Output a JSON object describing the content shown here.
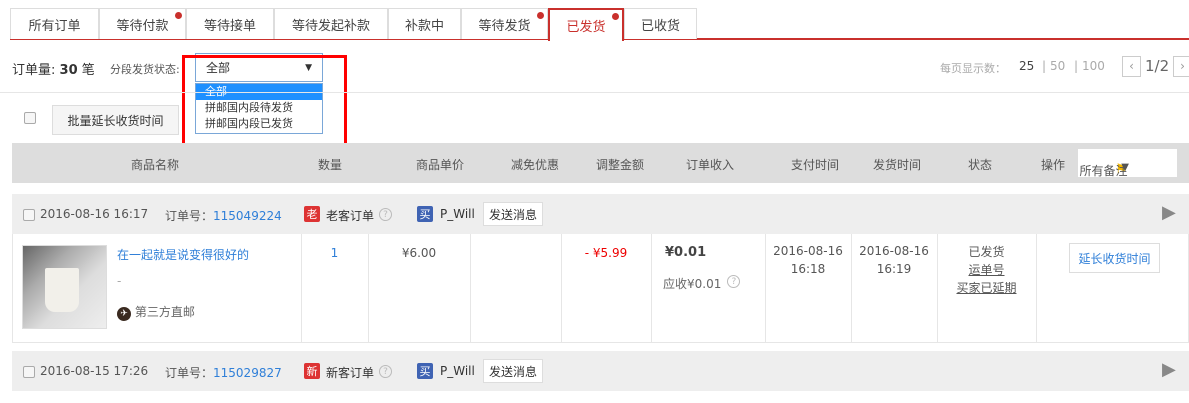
{
  "tabs": [
    {
      "label": "所有订单",
      "dot": false
    },
    {
      "label": "等待付款",
      "dot": true
    },
    {
      "label": "等待接单",
      "dot": false
    },
    {
      "label": "等待发起补款",
      "dot": false
    },
    {
      "label": "补款中",
      "dot": false
    },
    {
      "label": "等待发货",
      "dot": true
    },
    {
      "label": "已发货",
      "dot": true,
      "active": true
    },
    {
      "label": "已收货",
      "dot": false
    }
  ],
  "toolbar": {
    "count_label": "订单量:",
    "count": "30",
    "count_unit": "笔",
    "filter_label": "分段发货状态:",
    "filter_value": "全部",
    "filter_options": [
      "全部",
      "拼邮国内段待发货",
      "拼邮国内段已发货"
    ],
    "per_page_label": "每页显示数：",
    "per_page": [
      "25",
      "50",
      "100"
    ],
    "page": "1/2",
    "batch_button": "批量延长收货时间"
  },
  "columns": [
    "商品名称",
    "数量",
    "商品单价",
    "减免优惠",
    "调整金额",
    "订单收入",
    "支付时间",
    "发货时间",
    "状态",
    "操作"
  ],
  "notes_filter": "所有备注",
  "orders": [
    {
      "time": "2016-08-16 16:17",
      "order_no_label": "订单号：",
      "order_no": "115049224",
      "customer_badge": "老",
      "customer_type": "老客订单",
      "buyer_badge": "买",
      "buyer": "P_Will",
      "send_msg": "发送消息",
      "product": "在一起就是说变得很好的",
      "spec": "-",
      "shipping": "第三方直邮",
      "qty": "1",
      "price": "¥6.00",
      "discount": "",
      "adjust": "- ¥5.99",
      "income": "¥0.01",
      "receivable": "应收¥0.01",
      "pay_date": "2016-08-16",
      "pay_time": "16:18",
      "ship_date": "2016-08-16",
      "ship_time": "16:19",
      "status": "已发货",
      "tracking": "运单号",
      "extended": "买家已延期",
      "action": "延长收货时间"
    },
    {
      "time": "2016-08-15 17:26",
      "order_no_label": "订单号：",
      "order_no": "115029827",
      "customer_badge": "新",
      "customer_type": "新客订单",
      "buyer_badge": "买",
      "buyer": "P_Will",
      "send_msg": "发送消息"
    }
  ],
  "colors": {
    "accent": "#c9302c",
    "link": "#2f7fd8",
    "buyer_badge": "#3f63b3"
  }
}
